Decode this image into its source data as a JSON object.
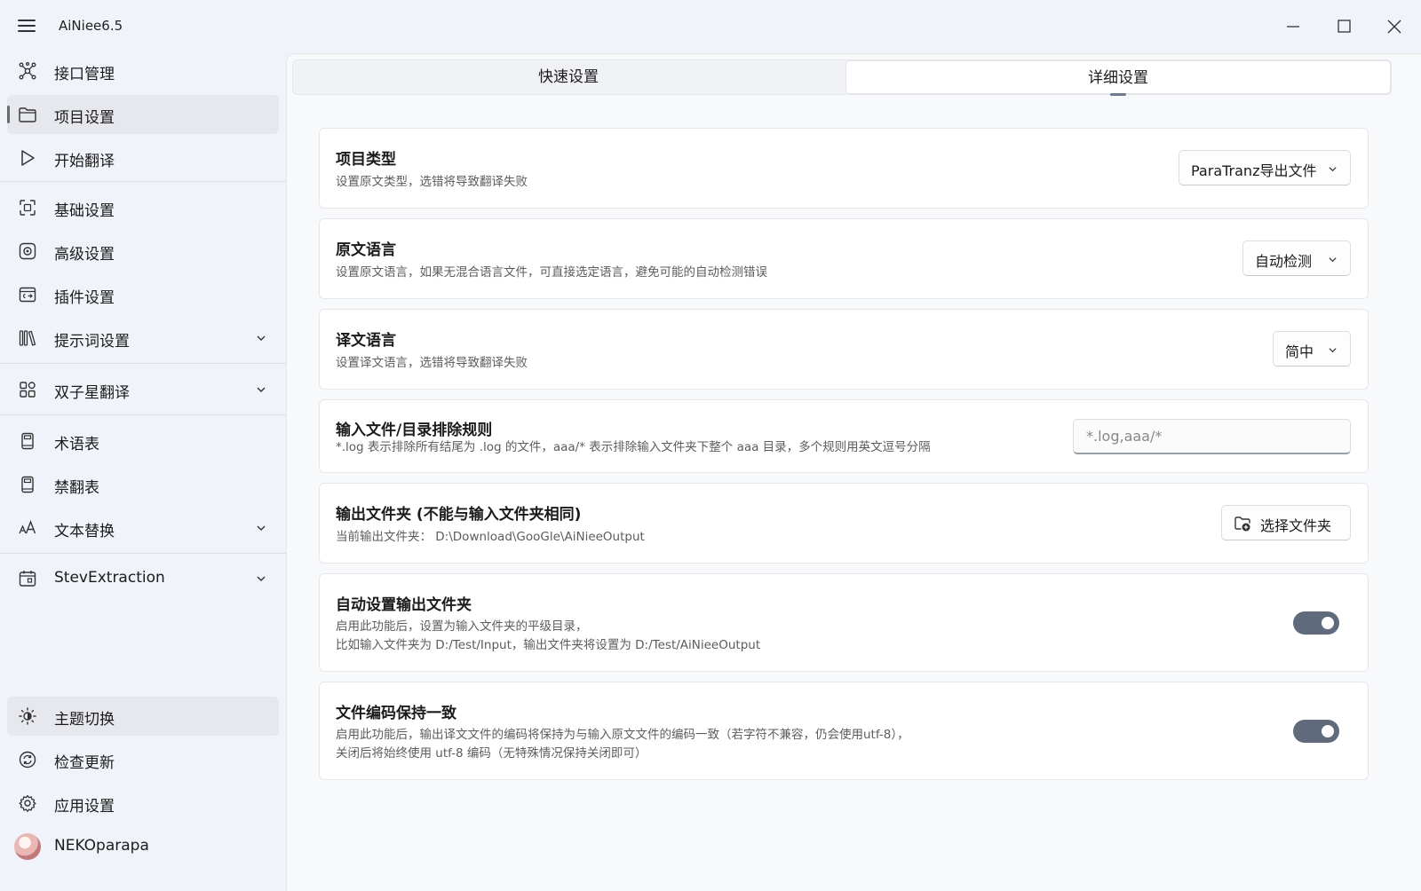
{
  "app": {
    "title": "AiNiee6.5"
  },
  "sidebar": {
    "items": [
      {
        "label": "接口管理",
        "icon": "network-icon"
      },
      {
        "label": "项目设置",
        "icon": "folder-icon",
        "selected": true
      },
      {
        "label": "开始翻译",
        "icon": "play-icon"
      },
      {
        "label": "基础设置",
        "icon": "basic-settings-icon"
      },
      {
        "label": "高级设置",
        "icon": "advanced-settings-icon"
      },
      {
        "label": "插件设置",
        "icon": "plugin-icon"
      },
      {
        "label": "提示词设置",
        "icon": "library-icon",
        "expandable": true
      },
      {
        "label": "双子星翻译",
        "icon": "apps-icon",
        "expandable": true
      },
      {
        "label": "术语表",
        "icon": "book-icon"
      },
      {
        "label": "禁翻表",
        "icon": "book-icon"
      },
      {
        "label": "文本替换",
        "icon": "font-size-icon",
        "expandable": true
      },
      {
        "label": "StevExtraction",
        "icon": "calendar-icon",
        "expandable": true
      }
    ],
    "bottom": [
      {
        "label": "主题切换",
        "icon": "brightness-icon"
      },
      {
        "label": "检查更新",
        "icon": "sync-icon"
      },
      {
        "label": "应用设置",
        "icon": "gear-icon"
      },
      {
        "label": "NEKOparapa",
        "icon": "avatar"
      }
    ]
  },
  "tabs": [
    {
      "label": "快速设置"
    },
    {
      "label": "详细设置",
      "active": true
    }
  ],
  "cards": {
    "project_type": {
      "title": "项目类型",
      "desc": "设置原文类型，选错将导致翻译失败",
      "value": "ParaTranz导出文件"
    },
    "source_lang": {
      "title": "原文语言",
      "desc": "设置原文语言，如果无混合语言文件，可直接选定语言，避免可能的自动检测错误",
      "value": "自动检测"
    },
    "target_lang": {
      "title": "译文语言",
      "desc": "设置译文语言，选错将导致翻译失败",
      "value": "简中"
    },
    "exclude_rules": {
      "title": "输入文件/目录排除规则",
      "desc": "*.log 表示排除所有结尾为 .log 的文件，aaa/* 表示排除输入文件夹下整个 aaa 目录，多个规则用英文逗号分隔",
      "placeholder": "*.log,aaa/*"
    },
    "output_folder": {
      "title": "输出文件夹 (不能与输入文件夹相同)",
      "desc": "当前输出文件夹：  D:\\Download\\GooGle\\AiNieeOutput",
      "button": "选择文件夹"
    },
    "auto_output": {
      "title": "自动设置输出文件夹",
      "desc1": "启用此功能后，设置为输入文件夹的平级目录，",
      "desc2": "比如输入文件夹为 D:/Test/Input，输出文件夹将设置为 D:/Test/AiNieeOutput",
      "enabled": true
    },
    "encoding": {
      "title": "文件编码保持一致",
      "desc1": "启用此功能后，输出译文文件的编码将保持为与输入原文文件的编码一致（若字符不兼容，仍会使用utf-8），",
      "desc2": "关闭后将始终使用 utf-8 编码（无特殊情况保持关闭即可）",
      "enabled": true
    }
  },
  "colors": {
    "toggle_on": "#5f6b7c",
    "sidebar_bg": "#f0f3f9",
    "selected_bg": "#e6e8ee"
  }
}
